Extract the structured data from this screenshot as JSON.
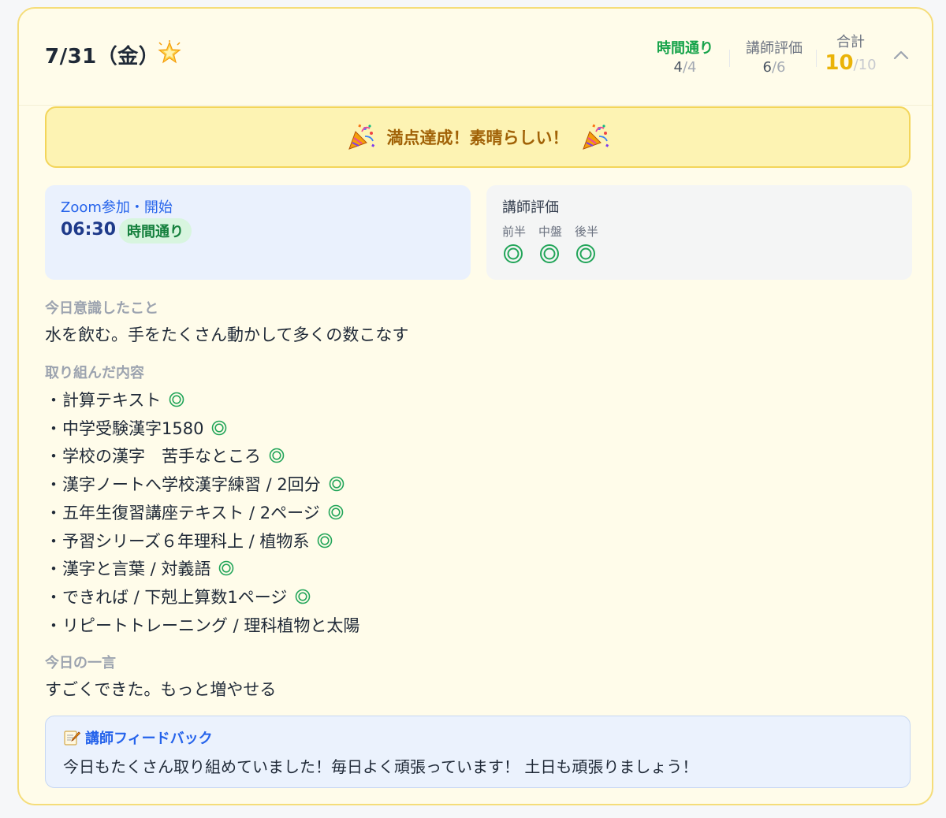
{
  "header": {
    "date": "7/31（金）",
    "scores": {
      "time": {
        "label": "時間通り",
        "value": "4",
        "max": "/4"
      },
      "teacher": {
        "label": "講師評価",
        "value": "6",
        "max": "/6"
      },
      "total": {
        "label": "合計",
        "value": "10",
        "max": "/10"
      }
    }
  },
  "banner": {
    "text": "満点達成！素晴らしい！"
  },
  "zoom": {
    "title": "Zoom参加・開始",
    "time": "06:30",
    "status": "時間通り"
  },
  "teacher_eval": {
    "title": "講師評価",
    "periods": [
      {
        "label": "前半",
        "mark": "◎"
      },
      {
        "label": "中盤",
        "mark": "◎"
      },
      {
        "label": "後半",
        "mark": "◎"
      }
    ]
  },
  "focus": {
    "label": "今日意識したこと",
    "text": "水を飲む。手をたくさん動かして多くの数こなす"
  },
  "tasks": {
    "label": "取り組んだ内容",
    "bullet": "・",
    "items": [
      {
        "text": "計算テキスト",
        "done": true
      },
      {
        "text": "中学受験漢字1580",
        "done": true
      },
      {
        "text": "学校の漢字　苦手なところ",
        "done": true
      },
      {
        "text": "漢字ノートへ学校漢字練習 / 2回分",
        "done": true
      },
      {
        "text": "五年生復習講座テキスト / 2ページ",
        "done": true
      },
      {
        "text": "予習シリーズ６年理科上 / 植物系",
        "done": true
      },
      {
        "text": "漢字と言葉 / 対義語",
        "done": true
      },
      {
        "text": "できれば / 下剋上算数1ページ",
        "done": true
      },
      {
        "text": "リピートトレーニング / 理科植物と太陽",
        "done": false
      }
    ]
  },
  "comment": {
    "label": "今日の一言",
    "text": "すごくできた。もっと増やせる"
  },
  "feedback": {
    "title": "講師フィードバック",
    "text": "今日もたくさん取り組めていました！毎日よく頑張っています！ 土日も頑張りましょう！"
  },
  "colors": {
    "card_border": "#f5dd7a",
    "card_bg": "#fffcea",
    "banner_bg": "#fdf3b3",
    "accent_blue": "#2563eb",
    "accent_green": "#16a34a",
    "accent_gold": "#eab308"
  },
  "icons": {
    "date_icon": "glowing-star-icon",
    "banner_icons": "party-popper-icon",
    "collapse_icon": "chevron-up-icon",
    "mark_icon": "double-circle-icon",
    "feedback_icon": "memo-icon"
  }
}
